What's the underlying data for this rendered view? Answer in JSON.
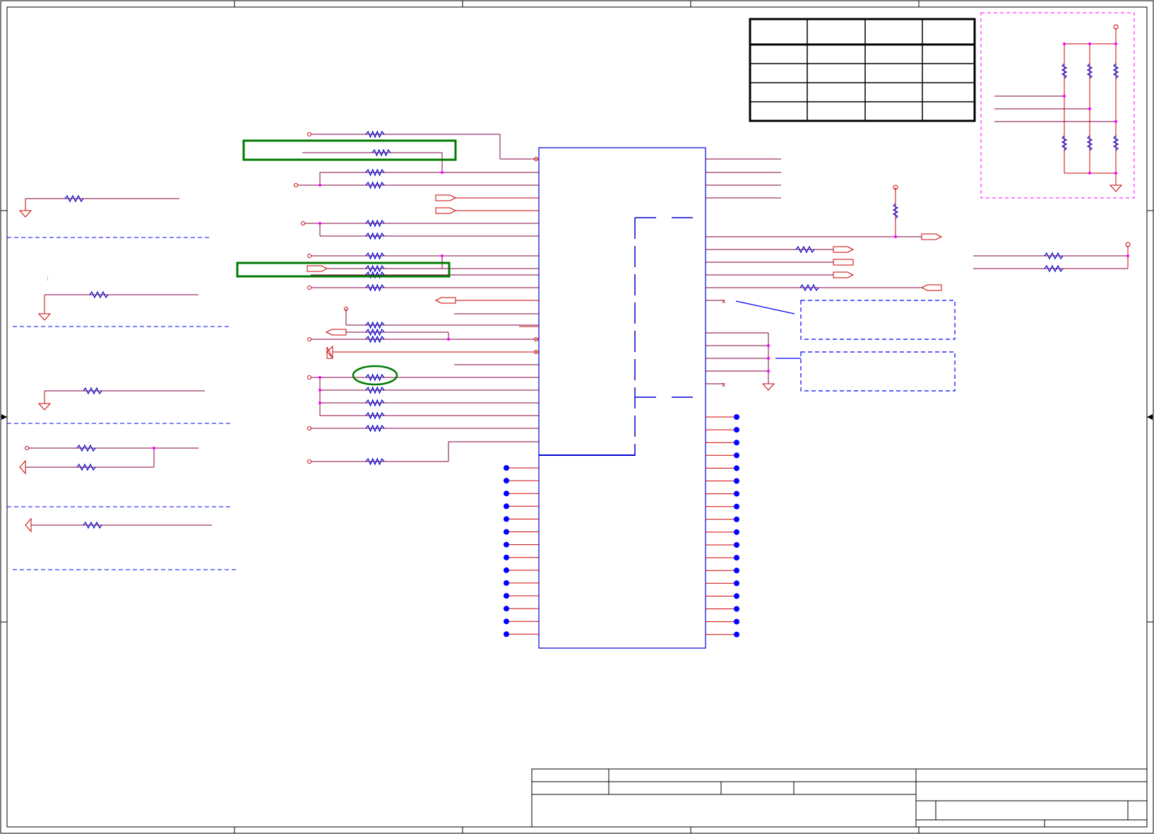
{
  "colors": {
    "background": "#ffffff",
    "frame": "#000000",
    "wire": "#cc0000",
    "net_line": "#800040",
    "component": "#0000cc",
    "junction": "#ff00ff",
    "highlight": "#007a00",
    "callout_box": "#0000ff",
    "option_box": "#ff00ff",
    "no_connect_dot": "#0000ff"
  },
  "diagram": {
    "description_items": [
      "drawing-frame",
      "revision-table",
      "main-ic-block",
      "inner-dashed-region",
      "series-resistor-network",
      "left-option-blocks",
      "pullup-pulldown-option-block",
      "callout-notes",
      "no-connect-pins",
      "title-block"
    ]
  }
}
